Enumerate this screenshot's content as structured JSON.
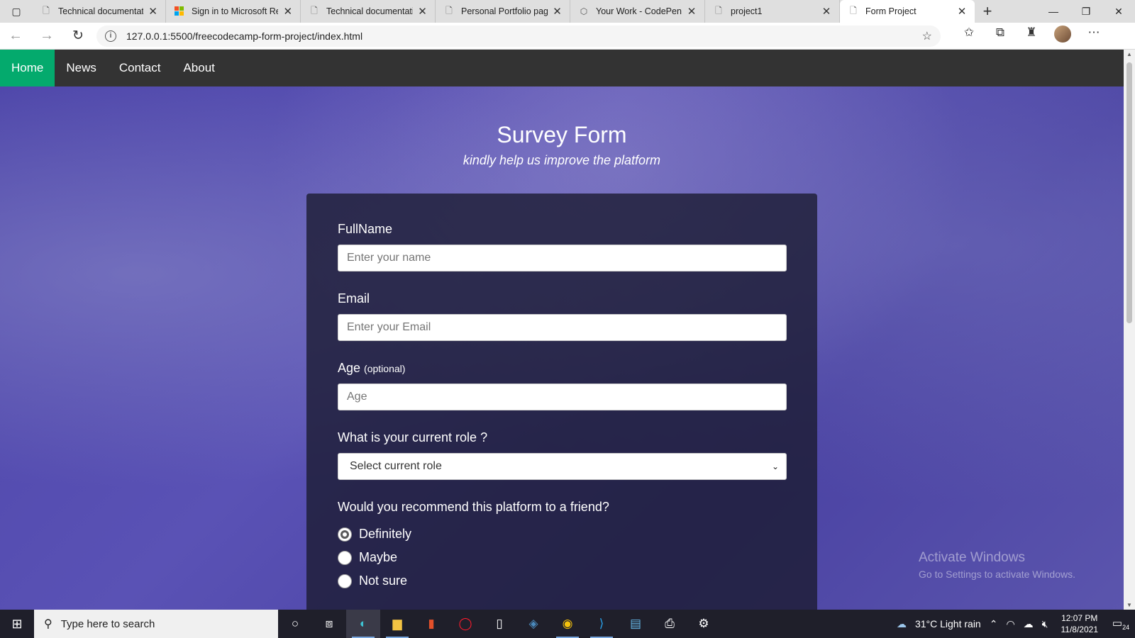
{
  "browser": {
    "tabs": [
      {
        "title": "Technical documentatio",
        "icon": "page-icon",
        "active": false
      },
      {
        "title": "Sign in to Microsoft Rew",
        "icon": "microsoft-icon",
        "active": false
      },
      {
        "title": "Technical documentatio",
        "icon": "page-icon",
        "active": false
      },
      {
        "title": "Personal Portfolio page",
        "icon": "page-icon",
        "active": false
      },
      {
        "title": "Your Work - CodePen",
        "icon": "codepen-icon",
        "active": false
      },
      {
        "title": "project1",
        "icon": "page-icon",
        "active": false
      },
      {
        "title": "Form Project",
        "icon": "page-icon",
        "active": true
      }
    ],
    "url": "127.0.0.1:5500/freecodecamp-form-project/index.html"
  },
  "page": {
    "nav": [
      "Home",
      "News",
      "Contact",
      "About"
    ],
    "title": "Survey Form",
    "subtitle": "kindly help us improve the platform",
    "form": {
      "name_label": "FullName",
      "name_placeholder": "Enter your name",
      "email_label": "Email",
      "email_placeholder": "Enter your Email",
      "age_label": "Age",
      "age_optional": "(optional)",
      "age_placeholder": "Age",
      "role_label": "What is your current role ?",
      "role_selected": "Select current role",
      "recommend_label": "Would you recommend this platform to a friend?",
      "recommend_options": [
        "Definitely",
        "Maybe",
        "Not sure"
      ]
    }
  },
  "watermark": {
    "line1": "Activate Windows",
    "line2": "Go to Settings to activate Windows."
  },
  "taskbar": {
    "search_placeholder": "Type here to search",
    "weather": "31°C  Light rain",
    "time": "12:07 PM",
    "date": "11/8/2021",
    "notification_count": "24"
  }
}
